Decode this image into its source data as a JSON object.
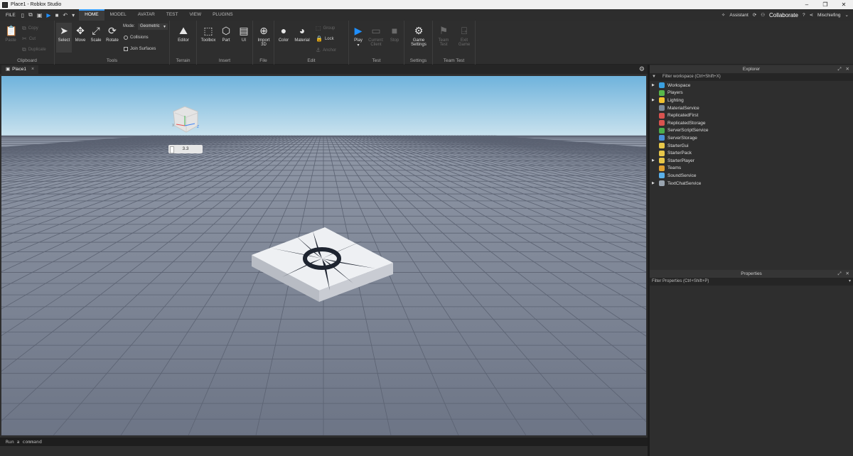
{
  "window": {
    "title": "Place1 - Roblox Studio",
    "controls": [
      "–",
      "❐",
      "✕"
    ]
  },
  "menubar": {
    "file": "FILE",
    "tabs": [
      "HOME",
      "MODEL",
      "AVATAR",
      "TEST",
      "VIEW",
      "PLUGINS"
    ],
    "active_tab": "HOME",
    "assistant": "Assistant",
    "collaborate": "Collaborate",
    "user": "Mischiefing"
  },
  "ribbon": {
    "clipboard": {
      "name": "Clipboard",
      "paste": "Paste",
      "copy": "Copy",
      "cut": "Cut",
      "duplicate": "Duplicate"
    },
    "tools": {
      "name": "Tools",
      "select": "Select",
      "move": "Move",
      "scale": "Scale",
      "rotate": "Rotate",
      "mode_label": "Mode:",
      "mode_value": "Geometric",
      "collisions": "Collisions",
      "join_surfaces": "Join Surfaces"
    },
    "terrain": {
      "name": "Terrain",
      "editor": "Editor"
    },
    "insert": {
      "name": "Insert",
      "toolbox": "Toolbox",
      "part": "Part",
      "ui": "UI"
    },
    "file": {
      "name": "File",
      "import3d_line1": "Import",
      "import3d_line2": "3D"
    },
    "edit": {
      "name": "Edit",
      "color": "Color",
      "material": "Material",
      "group": "Group",
      "lock": "Lock",
      "anchor": "Anchor"
    },
    "test": {
      "name": "Test",
      "play": "Play",
      "current_line1": "Current:",
      "current_line2": "Client",
      "stop": "Stop"
    },
    "settings": {
      "name": "Settings",
      "game_line1": "Game",
      "game_line2": "Settings"
    },
    "team_test": {
      "name": "Team Test",
      "team_line1": "Team",
      "team_line2": "Test",
      "exit_line1": "Exit",
      "exit_line2": "Game"
    }
  },
  "document": {
    "tab": "Place1"
  },
  "viewport": {
    "size_readout": "3.3"
  },
  "command_bar": {
    "placeholder": "Run a command"
  },
  "explorer": {
    "title": "Explorer",
    "filter": "Filter workspace (Ctrl+Shift+X)",
    "items": [
      {
        "label": "Workspace",
        "expandable": true,
        "icon": "workspace-icon",
        "color": "#3aa0e0"
      },
      {
        "label": "Players",
        "expandable": false,
        "icon": "players-icon",
        "color": "#58b84a"
      },
      {
        "label": "Lighting",
        "expandable": true,
        "icon": "lighting-icon",
        "color": "#f2c230"
      },
      {
        "label": "MaterialService",
        "expandable": false,
        "icon": "material-service-icon",
        "color": "#7c8a9a"
      },
      {
        "label": "ReplicatedFirst",
        "expandable": false,
        "icon": "replicated-first-icon",
        "color": "#d9534f"
      },
      {
        "label": "ReplicatedStorage",
        "expandable": false,
        "icon": "replicated-storage-icon",
        "color": "#d9534f"
      },
      {
        "label": "ServerScriptService",
        "expandable": false,
        "icon": "server-script-service-icon",
        "color": "#4cae4c"
      },
      {
        "label": "ServerStorage",
        "expandable": false,
        "icon": "server-storage-icon",
        "color": "#4a90d9"
      },
      {
        "label": "StarterGui",
        "expandable": false,
        "icon": "starter-gui-icon",
        "color": "#e8c84a"
      },
      {
        "label": "StarterPack",
        "expandable": false,
        "icon": "starter-pack-icon",
        "color": "#e8c84a"
      },
      {
        "label": "StarterPlayer",
        "expandable": true,
        "icon": "starter-player-icon",
        "color": "#e8c84a"
      },
      {
        "label": "Teams",
        "expandable": false,
        "icon": "teams-icon",
        "color": "#e0a030"
      },
      {
        "label": "SoundService",
        "expandable": false,
        "icon": "sound-service-icon",
        "color": "#5bb0e8"
      },
      {
        "label": "TextChatService",
        "expandable": true,
        "icon": "text-chat-service-icon",
        "color": "#9aa5b0"
      }
    ]
  },
  "properties": {
    "title": "Properties",
    "filter": "Filter Properties (Ctrl+Shift+P)"
  }
}
